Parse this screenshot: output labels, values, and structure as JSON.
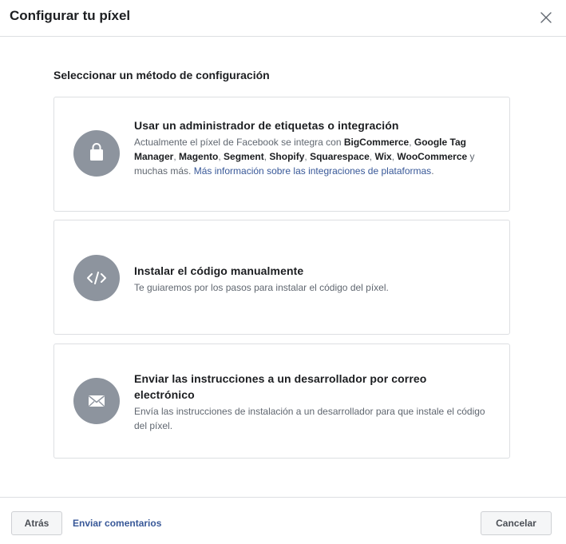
{
  "header": {
    "title": "Configurar tu píxel",
    "close_icon": "close-icon"
  },
  "section": {
    "title": "Seleccionar un método de configuración"
  },
  "options": [
    {
      "icon": "shopping-bag-icon",
      "title": "Usar un administrador de etiquetas o integración",
      "desc": {
        "prefix": "Actualmente el píxel de Facebook se integra con ",
        "p1": "BigCommerce",
        "sep1": ", ",
        "p2": "Google Tag Manager",
        "sep2": ", ",
        "p3": "Magento",
        "sep3": ", ",
        "p4": "Segment",
        "sep4": ", ",
        "p5": "Shopify",
        "sep5": ", ",
        "p6": "Squarespace",
        "sep6": ", ",
        "p7": "Wix",
        "sep7": ", ",
        "p8": "WooCommerce",
        "suffix": " y muchas más. ",
        "link": "Más información sobre las integraciones de plataformas"
      },
      "desc_end": "."
    },
    {
      "icon": "code-icon",
      "title": "Instalar el código manualmente",
      "desc": "Te guiaremos por los pasos para instalar el código del píxel."
    },
    {
      "icon": "envelope-icon",
      "title": "Enviar las instrucciones a un desarrollador por correo electrónico",
      "desc": "Envía las instrucciones de instalación a un desarrollador para que instale el código del píxel."
    }
  ],
  "footer": {
    "back_label": "Atrás",
    "feedback_label": "Enviar comentarios",
    "cancel_label": "Cancelar"
  },
  "colors": {
    "link": "#385898",
    "icon_circle": "#8d949e",
    "border": "#dddfe2",
    "button_bg": "#f5f6f7"
  }
}
